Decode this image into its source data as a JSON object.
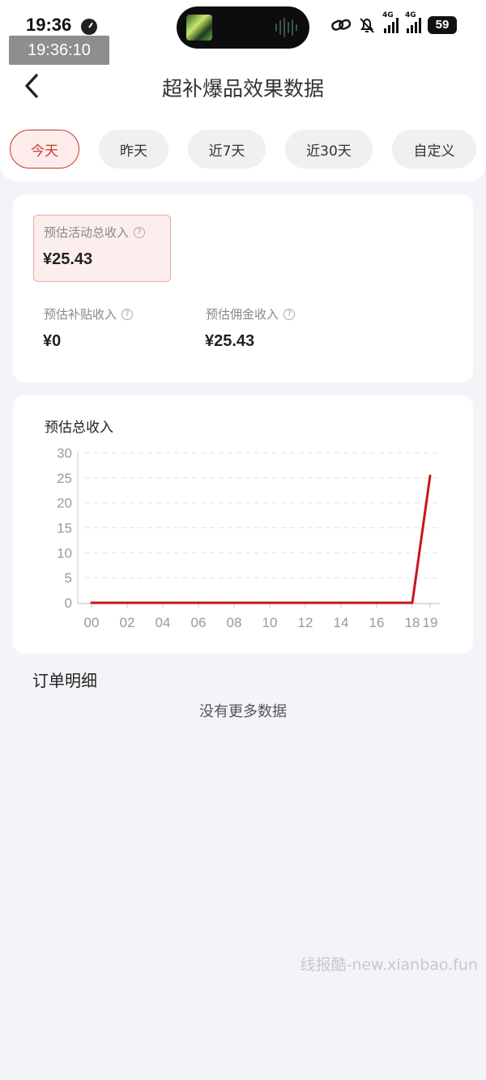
{
  "status_bar": {
    "time": "19:36",
    "overlay_time": "19:36:10",
    "network_tag_1": "4G",
    "network_tag_2": "4G",
    "battery": "59",
    "icons": [
      "alarm-clock-icon",
      "link-icon",
      "bell-mute-icon",
      "signal-icon",
      "signal-icon",
      "battery-icon"
    ]
  },
  "header": {
    "title": "超补爆品效果数据",
    "back_icon": "chevron-left-icon"
  },
  "tabs": [
    {
      "label": "今天",
      "active": true
    },
    {
      "label": "昨天",
      "active": false
    },
    {
      "label": "近7天",
      "active": false
    },
    {
      "label": "近30天",
      "active": false
    },
    {
      "label": "自定义",
      "active": false
    }
  ],
  "stats": {
    "total": {
      "label": "预估活动总收入",
      "value": "¥25.43"
    },
    "subsidy": {
      "label": "预估补贴收入",
      "value": "¥0"
    },
    "commission": {
      "label": "预估佣金收入",
      "value": "¥25.43"
    },
    "help_icon": "help-circle-icon"
  },
  "chart_data": {
    "type": "line",
    "title": "预估总收入",
    "xlabel": "",
    "ylabel": "",
    "x": [
      "00",
      "02",
      "04",
      "06",
      "08",
      "10",
      "12",
      "14",
      "16",
      "18",
      "19"
    ],
    "x_hours": [
      0,
      2,
      4,
      6,
      8,
      10,
      12,
      14,
      16,
      18,
      19
    ],
    "series": [
      {
        "name": "",
        "color": "#c8161d",
        "x": [
          0,
          2,
          4,
          6,
          8,
          10,
          12,
          14,
          16,
          18,
          19
        ],
        "values": [
          0,
          0,
          0,
          0,
          0,
          0,
          0,
          0,
          0,
          0,
          25.43
        ]
      }
    ],
    "yticks": [
      0,
      5,
      10,
      15,
      20,
      25,
      30
    ],
    "ylim": [
      0,
      30
    ],
    "xlim": [
      0,
      19
    ],
    "grid": true
  },
  "orders": {
    "title": "订单明细",
    "empty_text": "没有更多数据"
  },
  "watermark": "线报酷-new.xianbao.fun"
}
